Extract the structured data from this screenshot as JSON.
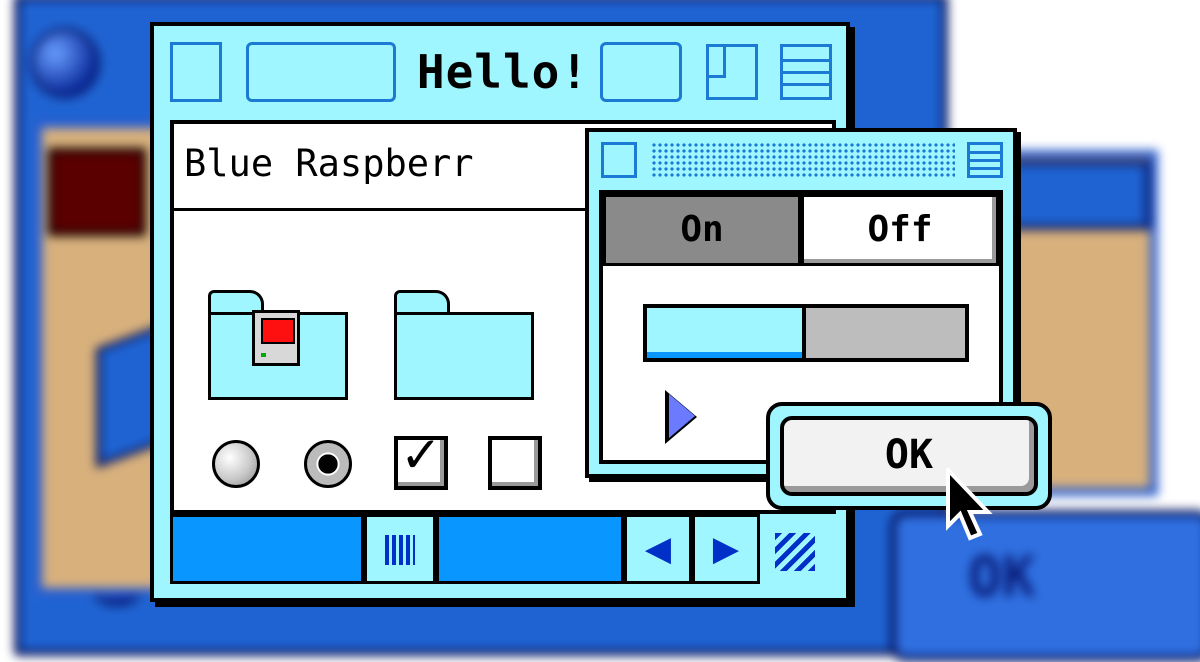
{
  "main_window": {
    "title": "Hello!",
    "field_text": "Blue Raspberr",
    "scrollbar": {
      "left_arrow": "◀",
      "right_arrow": "▶"
    }
  },
  "switch_window": {
    "on_label": "On",
    "off_label": "Off",
    "selected": "On",
    "progress": 0.5
  },
  "dialog": {
    "ok_label": "OK"
  },
  "background": {
    "ok_label": "OK"
  },
  "colors": {
    "window_bg": "#9ff6ff",
    "accent_blue": "#0a96ff",
    "border": "#000000"
  }
}
